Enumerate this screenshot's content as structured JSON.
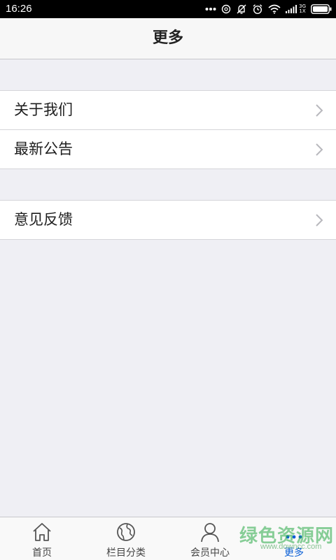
{
  "status_bar": {
    "time": "16:26",
    "network_label_top": "3G",
    "network_label_bottom": "1X"
  },
  "header": {
    "title": "更多"
  },
  "menu": {
    "group1": [
      {
        "label": "关于我们"
      },
      {
        "label": "最新公告"
      }
    ],
    "group2": [
      {
        "label": "意见反馈"
      }
    ]
  },
  "tabbar": {
    "tabs": [
      {
        "label": "首页",
        "icon": "home-icon"
      },
      {
        "label": "栏目分类",
        "icon": "globe-icon"
      },
      {
        "label": "会员中心",
        "icon": "user-icon"
      },
      {
        "label": "更多",
        "icon": "more-dots-icon",
        "active": true
      }
    ],
    "active_color": "#0a5fd6"
  },
  "watermark": {
    "main": "绿色资源网",
    "sub": "www.downcc.com"
  }
}
